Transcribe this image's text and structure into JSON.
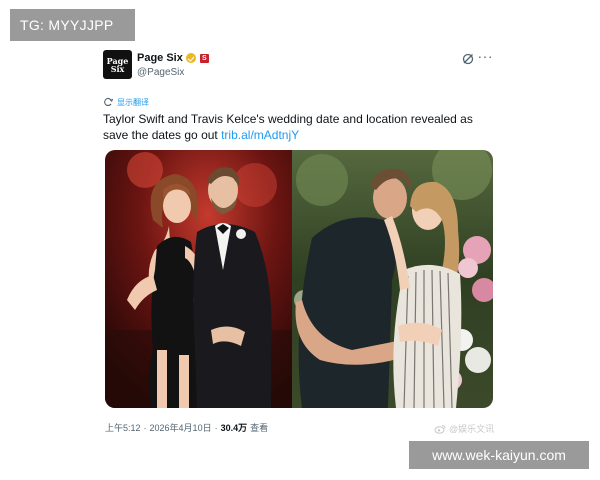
{
  "overlay_top": {
    "text": "TG: MYYJJPP"
  },
  "overlay_bottom": {
    "text": "www.wek-kaiyun.com"
  },
  "tweet": {
    "avatar": {
      "line1": "Page",
      "line2": "Six"
    },
    "author": {
      "display_name": "Page Six",
      "handle": "@PageSix"
    },
    "translate_label": "显示翻译",
    "text": "Taylor Swift and Travis Kelce's wedding date and location revealed as save the dates go out ",
    "link": "trib.al/mAdtnjY",
    "meta": {
      "time": "上午5:12",
      "separator": "·",
      "date": "2026年4月10日",
      "separator2": "·",
      "views": "30.4万",
      "views_label": "查看"
    }
  },
  "watermark": {
    "text": "@娱乐文讯"
  },
  "icons": {
    "verified": "verified-badge-icon",
    "affiliate": "page-six-affiliate-icon",
    "grok": "grok-icon",
    "more": "more-icon",
    "translate": "translate-icon",
    "weibo": "weibo-icon"
  },
  "colors": {
    "link": "#1d9bf0",
    "verified": "#e8b923",
    "affiliate": "#c8212c",
    "overlay": "#9a9a9a"
  }
}
